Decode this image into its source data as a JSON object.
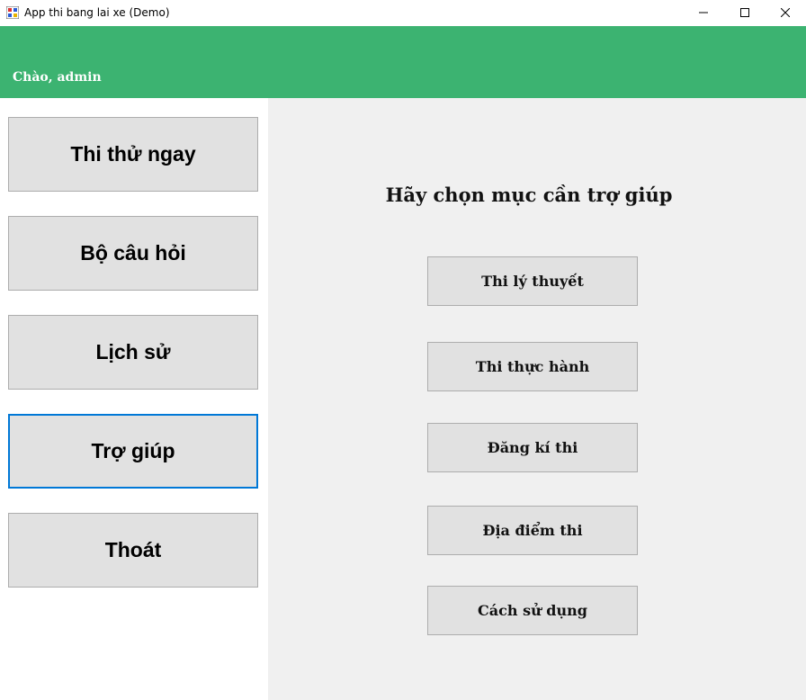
{
  "window": {
    "title": "App thi bang lai xe (Demo)",
    "app_icon": "app-icon",
    "controls": [
      "minimize-icon",
      "maximize-icon",
      "close-icon"
    ]
  },
  "header": {
    "greeting": "Chào, admin",
    "background": "#3cb371"
  },
  "sidebar": {
    "items": [
      {
        "label": "Thi thử ngay"
      },
      {
        "label": "Bộ câu hỏi"
      },
      {
        "label": "Lịch sử"
      },
      {
        "label": "Trợ giúp",
        "active": true
      },
      {
        "label": "Thoát"
      }
    ]
  },
  "main": {
    "title": "Hãy chọn mục cần trợ giúp",
    "buttons": [
      {
        "label": "Thi lý thuyết"
      },
      {
        "label": "Thi thực hành"
      },
      {
        "label": "Đăng kí thi"
      },
      {
        "label": "Địa điểm thi"
      },
      {
        "label": "Cách sử dụng"
      }
    ]
  },
  "colors": {
    "accent": "#0078d7",
    "button_bg": "#e1e1e1",
    "panel_bg": "#f0f0f0"
  }
}
